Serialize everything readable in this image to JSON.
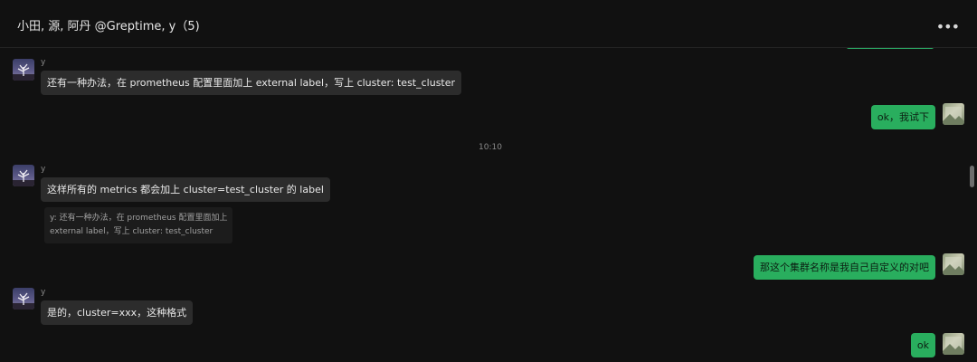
{
  "header": {
    "title": "小田, 源, 阿丹 @Greptime, y（5)",
    "more_icon": "ellipsis-icon"
  },
  "colors": {
    "background": "#111111",
    "incoming_bubble": "#2c2c2c",
    "outgoing_bubble": "#29ae5e",
    "quote_background": "#1c1c1c"
  },
  "messages": [
    {
      "sender": "y",
      "text": "还有一种办法，在 prometheus 配置里面加上 external label，写上     cluster: test_cluster"
    },
    {
      "text": "ok，我试下"
    },
    {
      "time": "10:10"
    },
    {
      "sender": "y",
      "text": "这样所有的 metrics 都会加上 cluster=test_cluster 的 label",
      "quote_line1": "y: 还有一种办法，在 prometheus 配置里面加上",
      "quote_line2": "external label，写上     cluster: test_cluster"
    },
    {
      "text": "那这个集群名称是我自己自定义的对吧"
    },
    {
      "sender": "y",
      "text": "是的，cluster=xxx，这种格式"
    },
    {
      "text": "ok"
    }
  ]
}
